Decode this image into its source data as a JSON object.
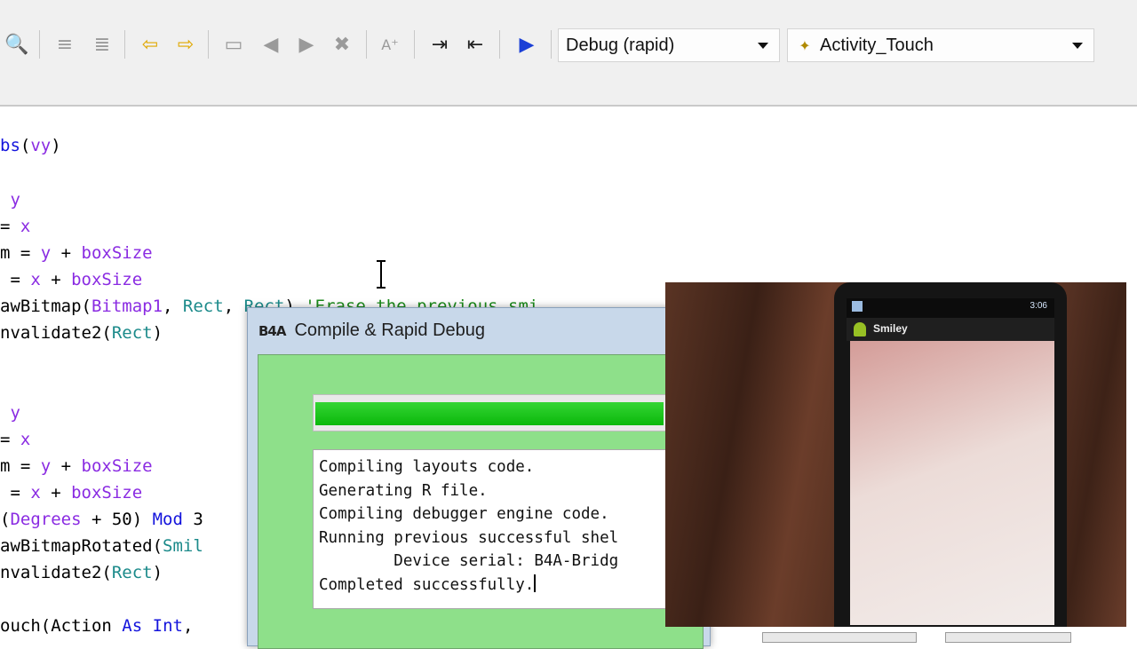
{
  "toolbar": {
    "config_combo": {
      "value": "Debug (rapid)"
    },
    "module_combo": {
      "value": "Activity_Touch"
    }
  },
  "code": {
    "lines": [
      [
        {
          "t": "bs",
          "c": "kw"
        },
        {
          "t": "(",
          "c": "fn"
        },
        {
          "t": "vy",
          "c": "var"
        },
        {
          "t": ")",
          "c": "fn"
        }
      ],
      [
        {
          "t": " y",
          "c": "var"
        }
      ],
      [
        {
          "t": "= ",
          "c": "fn"
        },
        {
          "t": "x",
          "c": "var"
        }
      ],
      [
        {
          "t": "m = ",
          "c": "fn"
        },
        {
          "t": "y",
          "c": "var"
        },
        {
          "t": " + ",
          "c": "fn"
        },
        {
          "t": "boxSize",
          "c": "var"
        }
      ],
      [
        {
          "t": " = ",
          "c": "fn"
        },
        {
          "t": "x",
          "c": "var"
        },
        {
          "t": " + ",
          "c": "fn"
        },
        {
          "t": "boxSize",
          "c": "var"
        }
      ],
      [
        {
          "t": "awBitmap(",
          "c": "fn"
        },
        {
          "t": "Bitmap1",
          "c": "var"
        },
        {
          "t": ", ",
          "c": "fn"
        },
        {
          "t": "Rect",
          "c": "typ"
        },
        {
          "t": ", ",
          "c": "fn"
        },
        {
          "t": "Rect",
          "c": "typ"
        },
        {
          "t": ") ",
          "c": "fn"
        },
        {
          "t": "'Erase the previous smi",
          "c": "cmt"
        }
      ],
      [
        {
          "t": "nvalidate2(",
          "c": "fn"
        },
        {
          "t": "Rect",
          "c": "typ"
        },
        {
          "t": ")",
          "c": "fn"
        }
      ],
      [
        {
          "t": " y",
          "c": "var"
        }
      ],
      [
        {
          "t": "= ",
          "c": "fn"
        },
        {
          "t": "x",
          "c": "var"
        }
      ],
      [
        {
          "t": "m = ",
          "c": "fn"
        },
        {
          "t": "y",
          "c": "var"
        },
        {
          "t": " + ",
          "c": "fn"
        },
        {
          "t": "boxSize",
          "c": "var"
        }
      ],
      [
        {
          "t": " = ",
          "c": "fn"
        },
        {
          "t": "x",
          "c": "var"
        },
        {
          "t": " + ",
          "c": "fn"
        },
        {
          "t": "boxSize",
          "c": "var"
        }
      ],
      [
        {
          "t": "(",
          "c": "fn"
        },
        {
          "t": "Degrees",
          "c": "var"
        },
        {
          "t": " + 50) ",
          "c": "fn"
        },
        {
          "t": "Mod",
          "c": "kw"
        },
        {
          "t": " 3",
          "c": "fn"
        }
      ],
      [
        {
          "t": "awBitmapRotated(",
          "c": "fn"
        },
        {
          "t": "Smil",
          "c": "typ"
        }
      ],
      [
        {
          "t": "nvalidate2(",
          "c": "fn"
        },
        {
          "t": "Rect",
          "c": "typ"
        },
        {
          "t": ")",
          "c": "fn"
        }
      ],
      [
        {
          "t": "ouch(Action ",
          "c": "fn"
        },
        {
          "t": "As",
          "c": "kw"
        },
        {
          "t": " ",
          "c": "fn"
        },
        {
          "t": "Int",
          "c": "kw"
        },
        {
          "t": ",",
          "c": "fn"
        }
      ]
    ]
  },
  "dialog": {
    "title": "Compile & Rapid Debug",
    "logo": "B4A",
    "progress": 0.9,
    "log_lines": [
      "Compiling layouts code.",
      "Generating R file.",
      "Compiling debugger engine code.",
      "Running previous successful shel",
      "        Device serial: B4A-Bridg",
      "Completed successfully."
    ]
  },
  "phone": {
    "time": "3:06",
    "app_title": "Smiley"
  }
}
